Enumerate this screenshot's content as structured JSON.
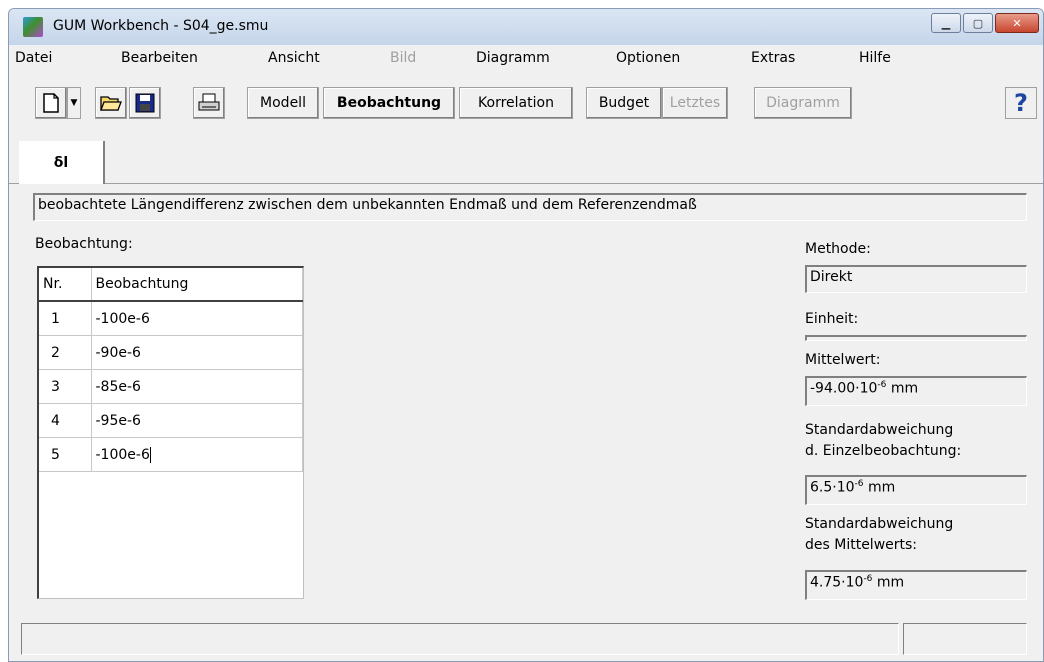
{
  "window": {
    "title": "GUM Workbench - S04_ge.smu",
    "minimize_icon": "minimize-icon",
    "maximize_icon": "maximize-icon",
    "close_icon": "close-icon"
  },
  "menu": [
    {
      "label": "Datei",
      "enabled": true
    },
    {
      "label": "Bearbeiten",
      "enabled": true
    },
    {
      "label": "Ansicht",
      "enabled": true
    },
    {
      "label": "Bild",
      "enabled": false
    },
    {
      "label": "Diagramm",
      "enabled": true
    },
    {
      "label": "Optionen",
      "enabled": true
    },
    {
      "label": "Extras",
      "enabled": true
    },
    {
      "label": "Hilfe",
      "enabled": true
    }
  ],
  "toolbar": {
    "icons": [
      "new-file-icon",
      "open-folder-icon",
      "save-icon",
      "print-icon",
      "help-icon"
    ],
    "modell": "Modell",
    "beobachtung": "Beobachtung",
    "korrelation": "Korrelation",
    "budget": "Budget",
    "letztes": "Letztes",
    "diagramm": "Diagramm",
    "help": "?"
  },
  "tabs": [
    {
      "label": "δl",
      "active": true
    }
  ],
  "main": {
    "description": "beobachtete Längendifferenz zwischen dem unbekannten Endmaß und dem Referenzendmaß",
    "observations_label": "Beobachtung:",
    "table": {
      "headers": [
        "Nr.",
        "Beobachtung"
      ],
      "rows": [
        {
          "nr": "1",
          "value": "-100e-6"
        },
        {
          "nr": "2",
          "value": "-90e-6"
        },
        {
          "nr": "3",
          "value": "-85e-6"
        },
        {
          "nr": "4",
          "value": "-95e-6"
        },
        {
          "nr": "5",
          "value": "-100e-6"
        }
      ]
    }
  },
  "side": {
    "methode_label": "Methode:",
    "methode_value": "Direkt",
    "einheit_label": "Einheit:",
    "einheit_value": "",
    "mittelwert_label": "Mittelwert:",
    "mittelwert_mantissa": "-94.00·10",
    "mittelwert_exp": "-6",
    "mittelwert_unit": " mm",
    "std_einzel_label_1": "Standardabweichung",
    "std_einzel_label_2": "d. Einzelbeobachtung:",
    "std_einzel_mantissa": "6.5·10",
    "std_einzel_exp": "-6",
    "std_einzel_unit": " mm",
    "std_mittel_label_1": "Standardabweichung",
    "std_mittel_label_2": "des Mittelwerts:",
    "std_mittel_mantissa": "4.75·10",
    "std_mittel_exp": "-6",
    "std_mittel_unit": " mm"
  },
  "status": {
    "left": "",
    "right": ""
  }
}
